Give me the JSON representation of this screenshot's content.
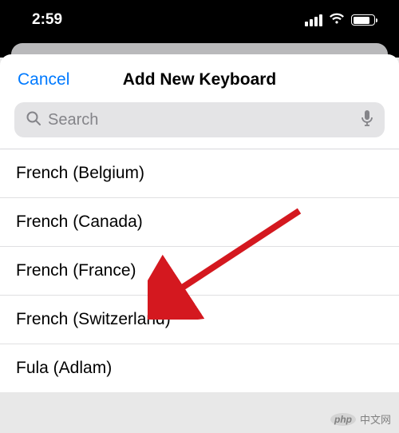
{
  "statusbar": {
    "time": "2:59"
  },
  "header": {
    "cancel_label": "Cancel",
    "title": "Add New Keyboard"
  },
  "search": {
    "placeholder": "Search"
  },
  "list": {
    "items": [
      {
        "label": "French (Belgium)"
      },
      {
        "label": "French (Canada)"
      },
      {
        "label": "French (France)"
      },
      {
        "label": "French (Switzerland)"
      },
      {
        "label": "Fula (Adlam)"
      }
    ]
  },
  "watermark": {
    "php": "php",
    "text": "中文网"
  }
}
